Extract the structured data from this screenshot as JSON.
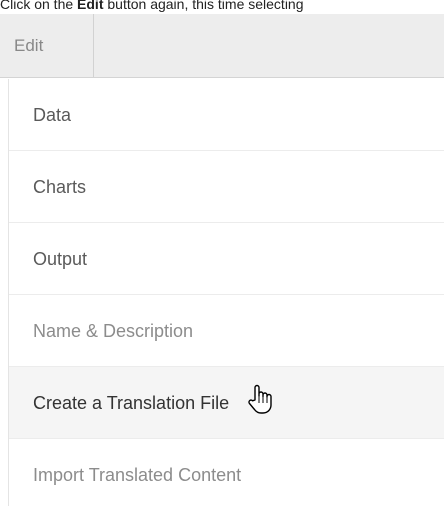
{
  "instruction": {
    "prefix": "Click on the ",
    "bold": "Edit",
    "suffix": " button again, this time selecting"
  },
  "menubar": {
    "edit_label": "Edit"
  },
  "menu": {
    "items": [
      {
        "label": "Data",
        "state": "enabled"
      },
      {
        "label": "Charts",
        "state": "enabled"
      },
      {
        "label": "Output",
        "state": "enabled"
      },
      {
        "label": "Name & Description",
        "state": "disabled"
      },
      {
        "label": "Create a Translation File",
        "state": "hovered"
      },
      {
        "label": "Import Translated Content",
        "state": "disabled"
      }
    ]
  },
  "cursor": {
    "icon": "hand-pointer-icon"
  },
  "colors": {
    "menubar_bg": "#ededed",
    "text": "#5a5a5a",
    "text_muted": "#8c8c8c",
    "hover_bg": "#f5f5f5"
  }
}
